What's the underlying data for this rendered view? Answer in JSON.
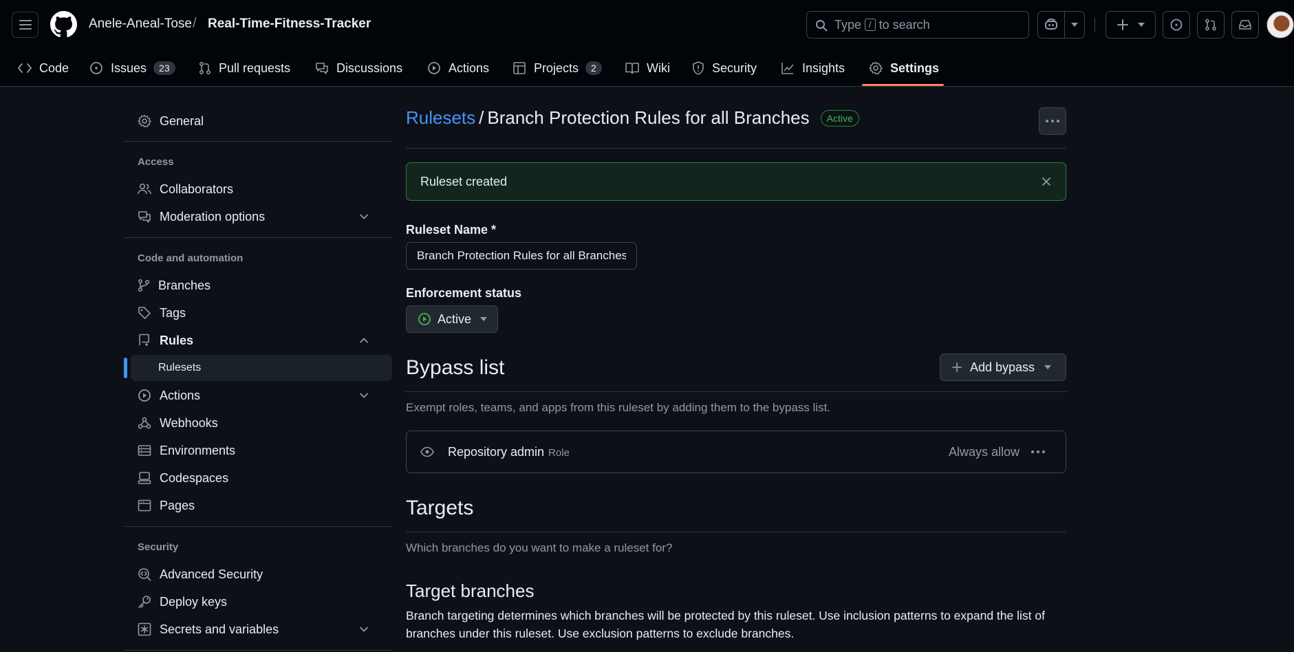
{
  "header": {
    "owner": "Anele-Aneal-Tose",
    "separator": "/",
    "repo": "Real-Time-Fitness-Tracker",
    "search": {
      "prefix": "Type",
      "key": "/",
      "suffix": "to search"
    }
  },
  "nav": {
    "tabs": [
      {
        "label": "Code",
        "icon": "code-icon"
      },
      {
        "label": "Issues",
        "icon": "issue-icon",
        "count": "23"
      },
      {
        "label": "Pull requests",
        "icon": "pull-request-icon"
      },
      {
        "label": "Discussions",
        "icon": "discussion-icon"
      },
      {
        "label": "Actions",
        "icon": "play-icon"
      },
      {
        "label": "Projects",
        "icon": "table-icon",
        "count": "2"
      },
      {
        "label": "Wiki",
        "icon": "book-icon"
      },
      {
        "label": "Security",
        "icon": "shield-icon"
      },
      {
        "label": "Insights",
        "icon": "graph-icon"
      },
      {
        "label": "Settings",
        "icon": "gear-icon",
        "selected": true
      }
    ]
  },
  "sidebar": {
    "general": "General",
    "access_heading": "Access",
    "collaborators": "Collaborators",
    "moderation": "Moderation options",
    "code_heading": "Code and automation",
    "branches": "Branches",
    "tags": "Tags",
    "rules": "Rules",
    "rulesets": "Rulesets",
    "actions": "Actions",
    "webhooks": "Webhooks",
    "environments": "Environments",
    "codespaces": "Codespaces",
    "pages": "Pages",
    "security_heading": "Security",
    "advanced_security": "Advanced Security",
    "deploy_keys": "Deploy keys",
    "secrets": "Secrets and variables"
  },
  "main": {
    "breadcrumb_link": "Rulesets",
    "breadcrumb_sep": "/",
    "title": "Branch Protection Rules for all Branches",
    "status_badge": "Active",
    "flash": "Ruleset created",
    "name_label": "Ruleset Name *",
    "name_value": "Branch Protection Rules for all Branches",
    "enforcement_label": "Enforcement status",
    "enforcement_value": "Active",
    "bypass_heading": "Bypass list",
    "add_bypass": "Add bypass",
    "bypass_desc": "Exempt roles, teams, and apps from this ruleset by adding them to the bypass list.",
    "bypass_item": {
      "name": "Repository admin",
      "type": "Role",
      "mode": "Always allow"
    },
    "targets_heading": "Targets",
    "targets_desc": "Which branches do you want to make a ruleset for?",
    "target_branches_heading": "Target branches",
    "target_branches_desc": "Branch targeting determines which branches will be protected by this ruleset. Use inclusion patterns to expand the list of branches under this ruleset. Use exclusion patterns to exclude branches."
  },
  "colors": {
    "background": "#0d1117",
    "header": "#010409",
    "link": "#4493f8",
    "success": "#3fb950",
    "selected_tab": "#f78166"
  }
}
